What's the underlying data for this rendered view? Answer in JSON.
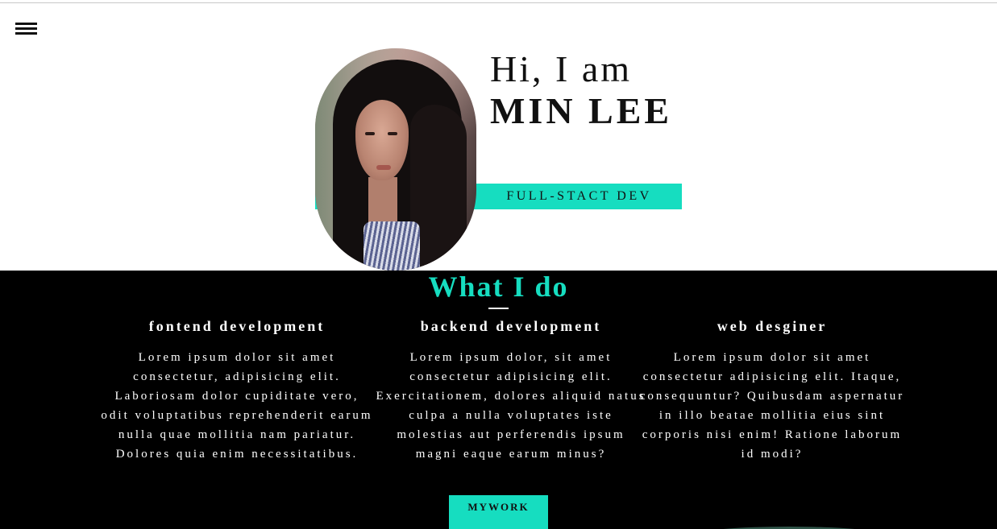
{
  "nav": {
    "menu_icon": "hamburger-menu-icon"
  },
  "hero": {
    "greeting": "Hi, I am",
    "name": "MIN LEE",
    "role": "FULL-STACT DEV",
    "accent_color": "#16ddc0"
  },
  "services": {
    "title": "What I do",
    "items": [
      {
        "heading": "fontend development",
        "text": "Lorem ipsum dolor sit amet consectetur, adipisicing elit. Laboriosam dolor cupiditate vero, odit voluptatibus reprehenderit earum nulla quae mollitia nam pariatur. Dolores quia enim necessitatibus."
      },
      {
        "heading": "backend development",
        "text": "Lorem ipsum dolor, sit amet consectetur adipisicing elit. Exercitationem, dolores aliquid natus culpa a nulla voluptates iste molestias aut perferendis ipsum magni eaque earum minus?"
      },
      {
        "heading": "web desginer",
        "text": "Lorem ipsum dolor sit amet consectetur adipisicing elit. Itaque, consequuntur? Quibusdam aspernatur in illo beatae mollitia eius sint corporis nisi enim! Ratione laborum id modi?"
      }
    ],
    "cta_label": "MYWORK"
  }
}
